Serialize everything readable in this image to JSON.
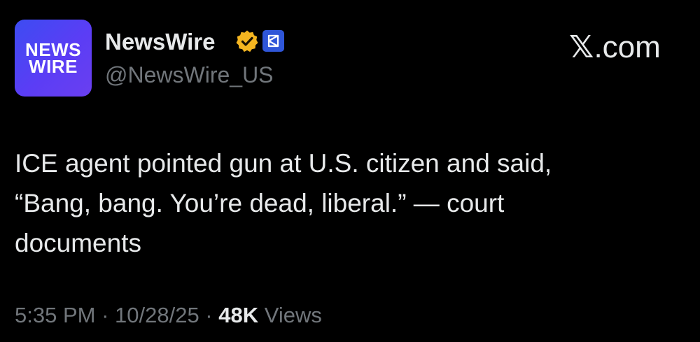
{
  "avatar": {
    "line1": "NEWS",
    "line2": "WIRE",
    "bg_color": "#4a44f3"
  },
  "author": {
    "display_name": "NewsWire",
    "handle": "@NewsWire_US",
    "verified_badge_color": "#f4b520",
    "affiliate_badge_color": "#2f56d8",
    "verified_icon": "verified-badge-icon",
    "affiliate_icon": "affiliate-badge-icon"
  },
  "brand": {
    "x_glyph": "𝕏",
    "suffix": ".com"
  },
  "tweet": {
    "lines": [
      "ICE agent pointed gun at U.S. citizen and said,",
      "“Bang, bang. You’re dead, liberal.” — court",
      "documents"
    ]
  },
  "meta": {
    "time": "5:35 PM",
    "sep1": " · ",
    "date": "10/28/25",
    "sep2": " · ",
    "views_count": "48K",
    "views_label": " Views"
  },
  "colors": {
    "background": "#000000",
    "primary_text": "#e7e9ea",
    "secondary_text": "#71767b"
  }
}
